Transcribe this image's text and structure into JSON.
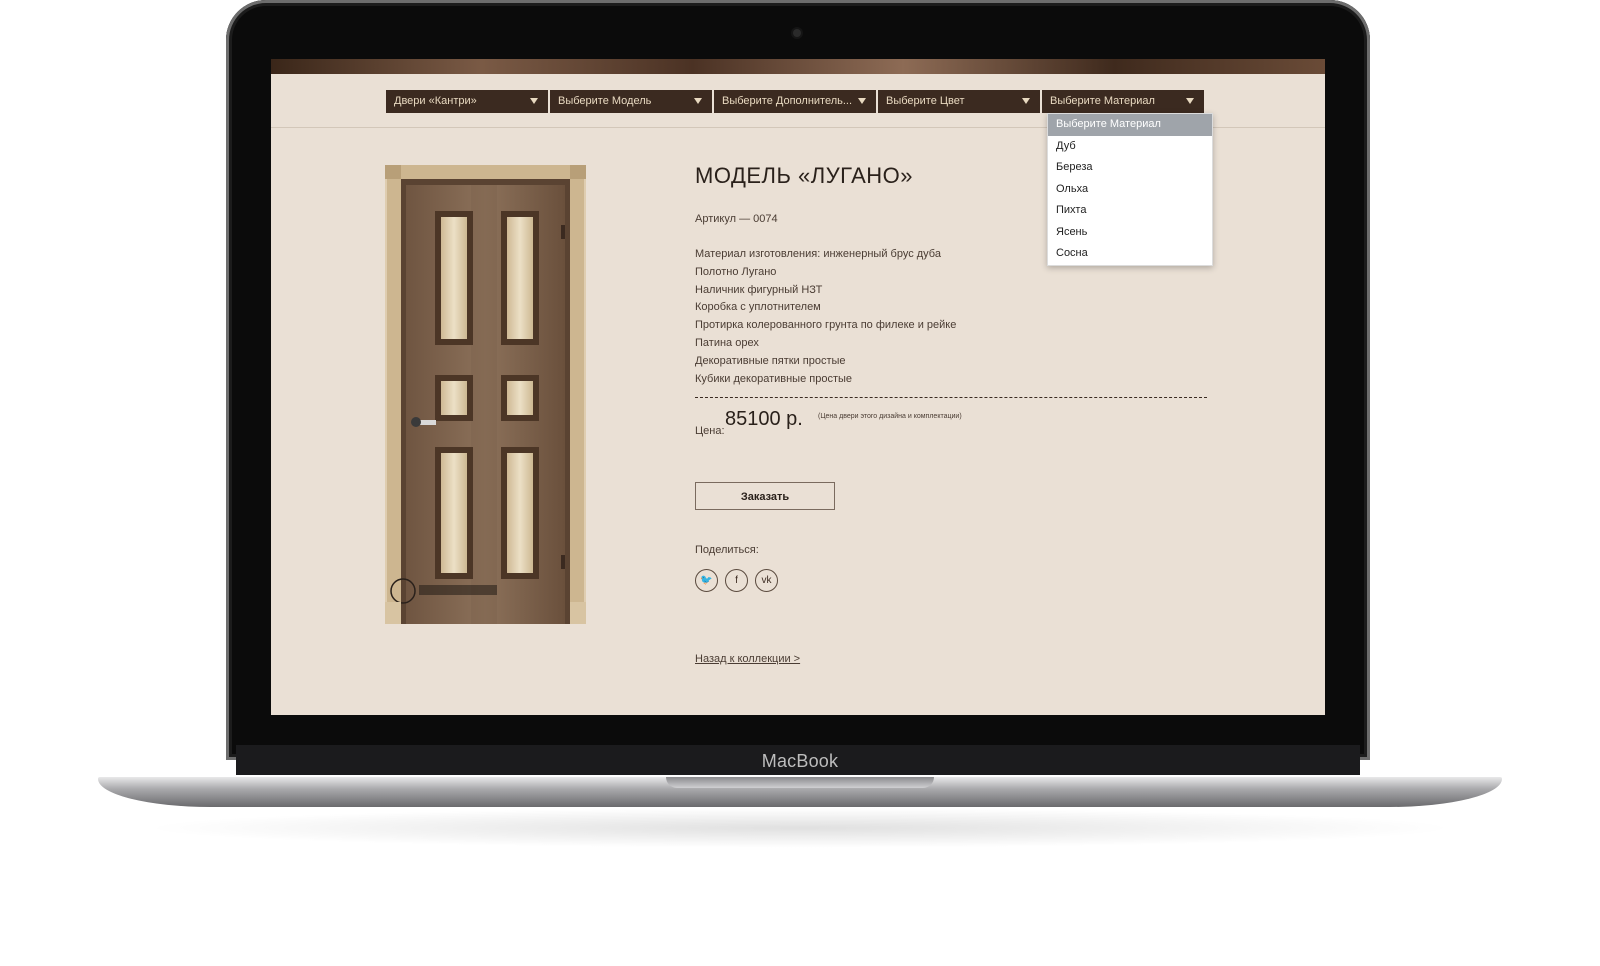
{
  "device": {
    "brand": "MacBook"
  },
  "filters": [
    {
      "label": "Двери «Кантри»"
    },
    {
      "label": "Выберите Модель"
    },
    {
      "label": "Выберите Дополнитель..."
    },
    {
      "label": "Выберите Цвет"
    },
    {
      "label": "Выберите Материал"
    }
  ],
  "material_dropdown": {
    "selected": "Выберите Материал",
    "options": [
      "Выберите Материал",
      "Дуб",
      "Береза",
      "Ольха",
      "Пихта",
      "Ясень",
      "Сосна"
    ]
  },
  "product": {
    "title": "МОДЕЛЬ «ЛУГАНО»",
    "sku": "Артикул — 0074",
    "features": [
      "Материал изготовления: инженерный брус дуба",
      "Полотно Лугано",
      "Наличник фигурный НЗТ",
      "Коробка с уплотнителем",
      "Протирка колерованного грунта по филеке и рейке",
      "Патина орех",
      "Декоративные пятки простые",
      "Кубики декоративные простые"
    ],
    "price_label": "Цена:",
    "price_value": "85100 р.",
    "price_note": "(Цена двери этого дизайна и комплектации)",
    "order_button": "Заказать",
    "share_label": "Поделиться:",
    "social": {
      "twitter": "🐦",
      "facebook": "f",
      "vk": "vk"
    },
    "back_link": "Назад к коллекции >"
  },
  "colors": {
    "select_bg": "#3b2a20",
    "page_bg": "#eae0d5",
    "dropdown_selected": "#9fa4aa"
  }
}
